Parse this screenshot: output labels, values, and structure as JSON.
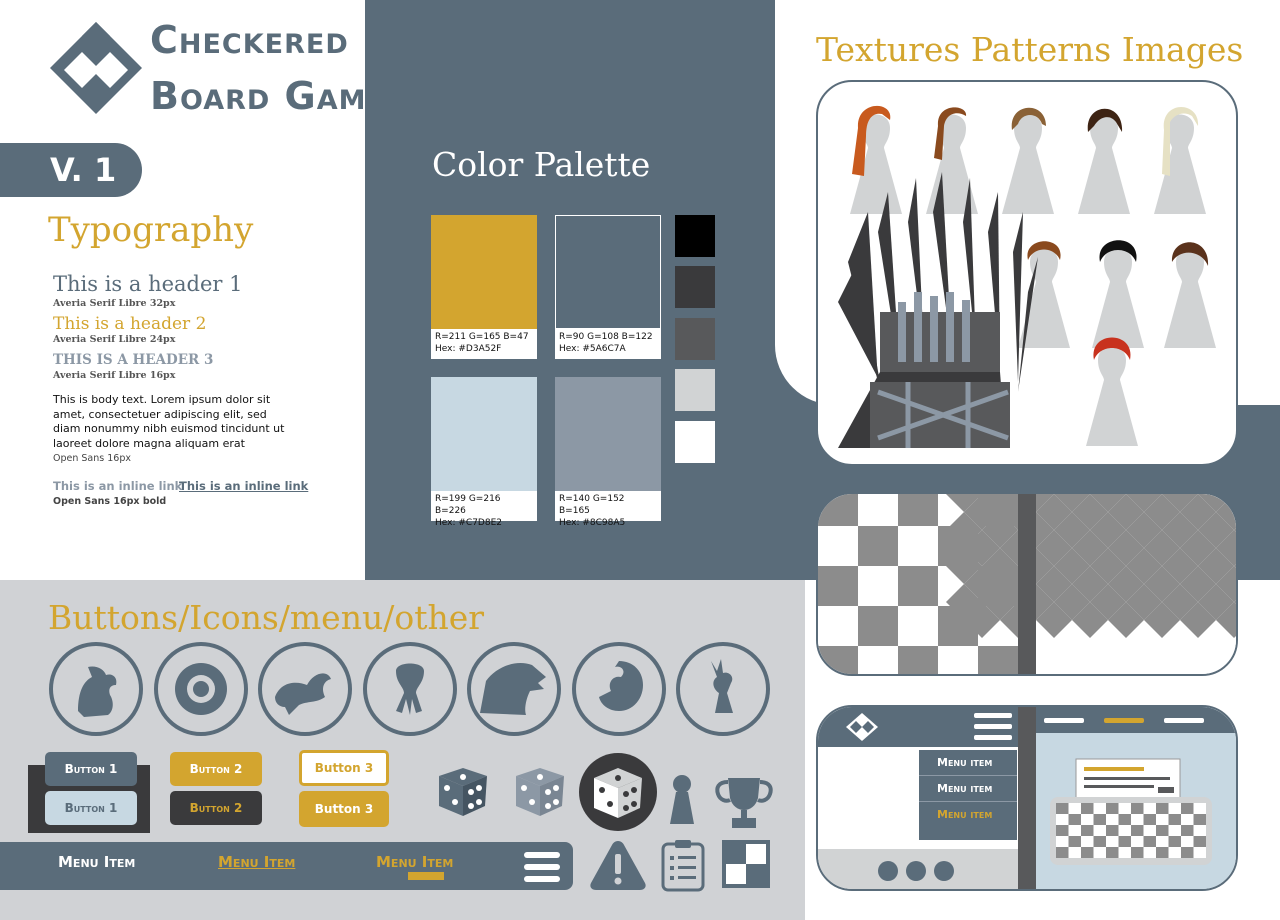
{
  "brand": {
    "line1": "Checkered",
    "line2": "Board Games",
    "version": "V. 1"
  },
  "typography": {
    "title": "Typography",
    "h1": "This is a header 1",
    "h1_caption": "Averia Serif Libre 32px",
    "h2": "This is a header 2",
    "h2_caption": "Averia Serif Libre 24px",
    "h3": "THIS IS A HEADER 3",
    "h3_caption": "Averia Serif Libre 16px",
    "body": "This is body text. Lorem ipsum dolor sit amet, consectetuer adipiscing elit, sed diam nonummy nibh euismod tincidunt ut laoreet dolore magna aliquam erat",
    "body_caption": "Open Sans 16px",
    "link_visited": "This is an inline link",
    "link": "This is an inline link",
    "link_caption": "Open Sans 16px bold"
  },
  "palette": {
    "title": "Color Palette",
    "swatches": [
      {
        "rgb": "R=211 G=165 B=47",
        "hex": "Hex: #D3A52F",
        "color": "#D3A52F"
      },
      {
        "rgb": "R=90 G=108 B=122",
        "hex": "Hex: #5A6C7A",
        "color": "#5A6C7A"
      },
      {
        "rgb": "R=199 G=216 B=226",
        "hex": "Hex: #C7D8E2",
        "color": "#C7D8E2"
      },
      {
        "rgb": "R=140 G=152 B=165",
        "hex": "Hex: #8C98A5",
        "color": "#8C98A5"
      }
    ],
    "greys": [
      "#000000",
      "#3A3A3C",
      "#58595B",
      "#D1D3D4",
      "#FFFFFF"
    ]
  },
  "textures": {
    "title": "Textures Patterns Images"
  },
  "components": {
    "title": "Buttons/Icons/menu/other",
    "button1": "Button 1",
    "button2": "Button 2",
    "button3": "Button 3",
    "menu_item": "Menu Item",
    "sigils": [
      "lion-sigil-icon",
      "rose-sigil-icon",
      "manticore-sigil-icon",
      "kraken-sigil-icon",
      "direwolf-sigil-icon",
      "dragon-sigil-icon",
      "stag-sigil-icon"
    ]
  },
  "mock_ui": {
    "menu": [
      "Menu item",
      "Menu item",
      "Menu item"
    ]
  }
}
